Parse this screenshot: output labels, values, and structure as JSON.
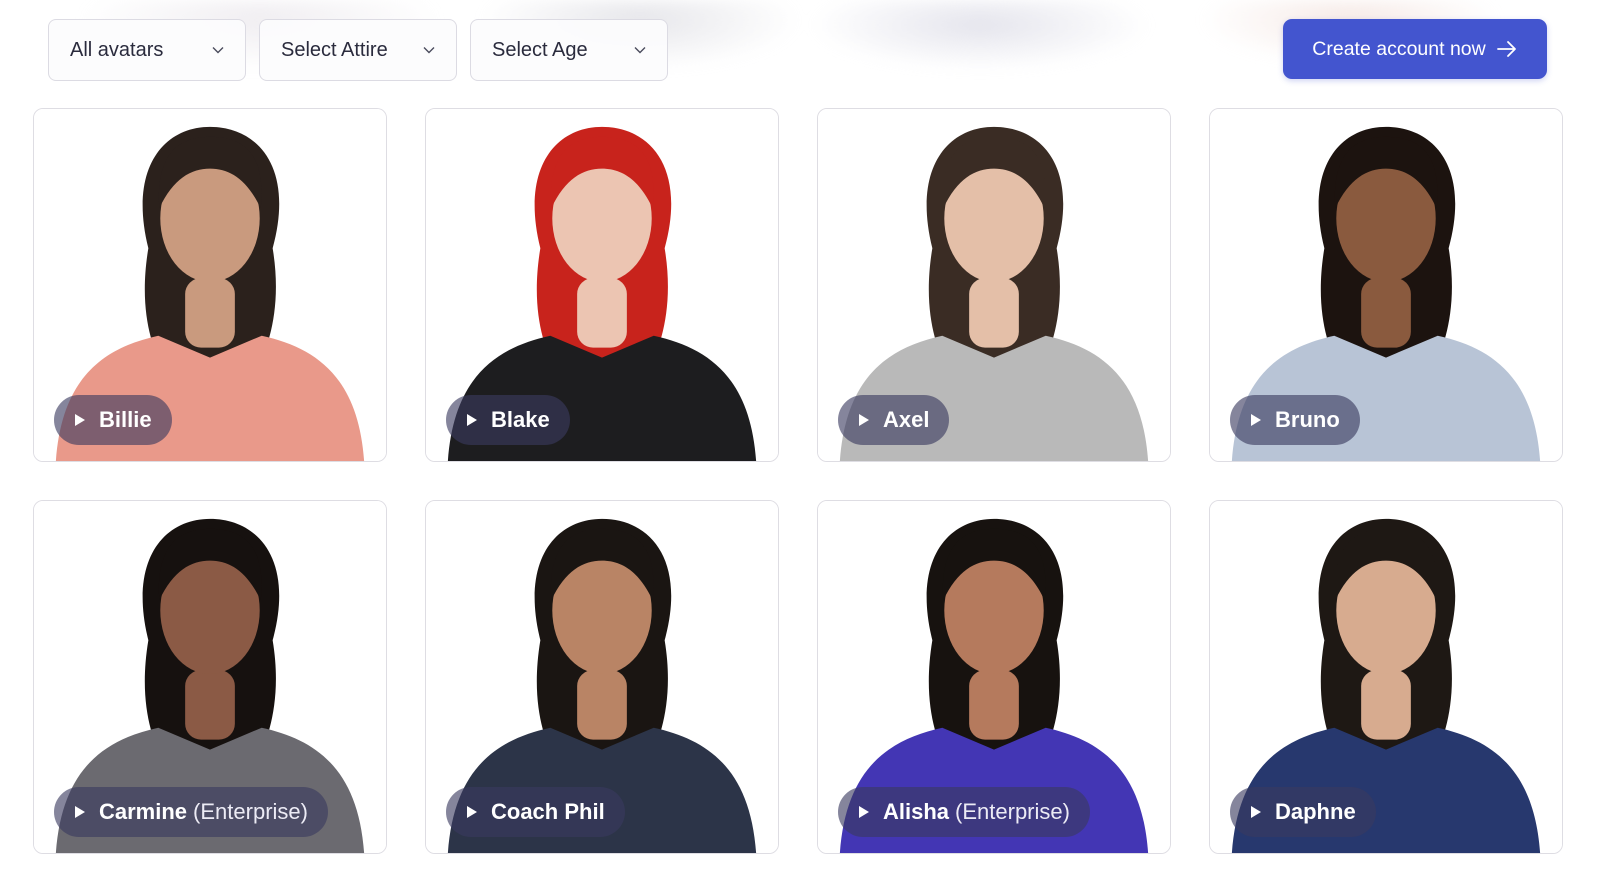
{
  "filters": [
    {
      "label": "All avatars",
      "icon": "chevron-down-icon"
    },
    {
      "label": "Select Attire",
      "icon": "chevron-down-icon"
    },
    {
      "label": "Select Age",
      "icon": "chevron-down-icon"
    }
  ],
  "cta": {
    "label": "Create account now",
    "icon": "arrow-right-icon",
    "color": "#4355cf"
  },
  "avatars": [
    {
      "name": "Billie",
      "tier": "",
      "skin": "#c99a7e",
      "hair": "#2b211c",
      "top": "#e9998a",
      "bg": "#ffffff"
    },
    {
      "name": "Blake",
      "tier": "",
      "skin": "#ecc5b2",
      "hair": "#c8231c",
      "top": "#1d1d1f",
      "bg": "#ffffff"
    },
    {
      "name": "Axel",
      "tier": "",
      "skin": "#e4bfa8",
      "hair": "#3a2c24",
      "top": "#b9b9b9",
      "bg": "#ffffff"
    },
    {
      "name": "Bruno",
      "tier": "",
      "skin": "#8a5a3e",
      "hair": "#1c130f",
      "top": "#b8c4d6",
      "bg": "#ffffff"
    },
    {
      "name": "Carmine",
      "tier": "(Enterprise)",
      "skin": "#8b5a45",
      "hair": "#16110f",
      "top": "#6b6a70",
      "bg": "#ffffff"
    },
    {
      "name": "Coach Phil",
      "tier": "",
      "skin": "#b98465",
      "hair": "#1a1512",
      "top": "#2c3448",
      "bg": "#ffffff"
    },
    {
      "name": "Alisha",
      "tier": "(Enterprise)",
      "skin": "#b57a5d",
      "hair": "#17120f",
      "top": "#4336b4",
      "bg": "#ffffff"
    },
    {
      "name": "Daphne",
      "tier": "",
      "skin": "#d7ab8f",
      "hair": "#1e1814",
      "top": "#27386e",
      "bg": "#ffffff"
    }
  ]
}
